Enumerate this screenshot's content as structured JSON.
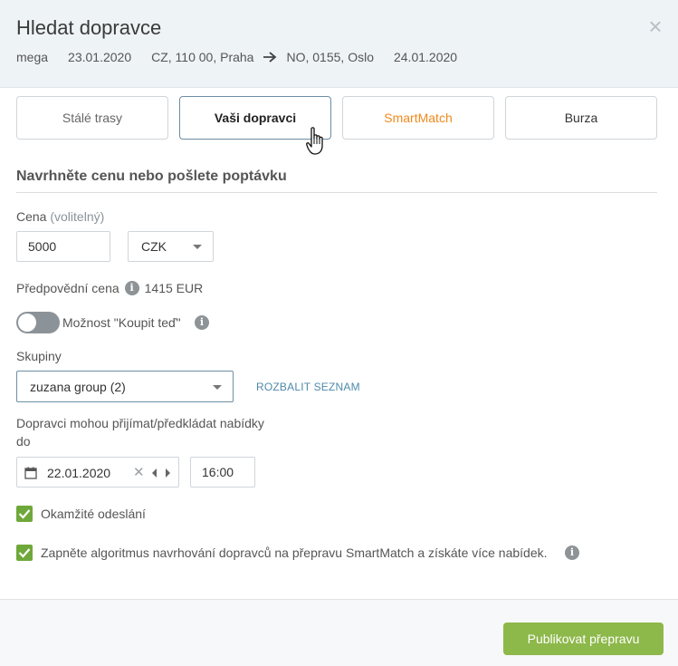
{
  "header": {
    "title": "Hledat dopravce",
    "route": {
      "company": "mega",
      "date_from": "23.01.2020",
      "origin": "CZ, 110 00, Praha",
      "destination": "NO, 0155, Oslo",
      "date_to": "24.01.2020"
    },
    "close_symbol": "×"
  },
  "tabs": [
    {
      "label": "Stálé trasy"
    },
    {
      "label": "Vaši dopravci"
    },
    {
      "label": "SmartMatch"
    },
    {
      "label": "Burza"
    }
  ],
  "form": {
    "section_title": "Navrhněte cenu nebo pošlete poptávku",
    "price_label": "Cena",
    "price_optional": "(volitelný)",
    "price_value": "5000",
    "currency_value": "CZK",
    "forecast_label": "Předpovědní cena",
    "forecast_value": "1415 EUR",
    "buy_now_label": "Možnost \"Koupit teď\"",
    "groups_label": "Skupiny",
    "groups_value": "zuzana group (2)",
    "expand_link": "ROZBALIT SEZNAM",
    "deadline_label_1": "Dopravci mohou přijímat/předkládat nabídky",
    "deadline_label_2": "do",
    "deadline_date": "22.01.2020",
    "deadline_time": "16:00",
    "instant_send_label": "Okamžité odeslání",
    "smartmatch_label": "Zapněte algoritmus navrhování dopravců na přepravu SmartMatch a získáte více nabídek."
  },
  "footer": {
    "publish_label": "Publikovat přepravu"
  },
  "icons": {
    "info": "i"
  },
  "colors": {
    "accent_green": "#8db84a",
    "checkbox_green": "#6fa83a",
    "smartmatch_orange": "#f08a1c",
    "link_blue": "#4f8aab"
  }
}
